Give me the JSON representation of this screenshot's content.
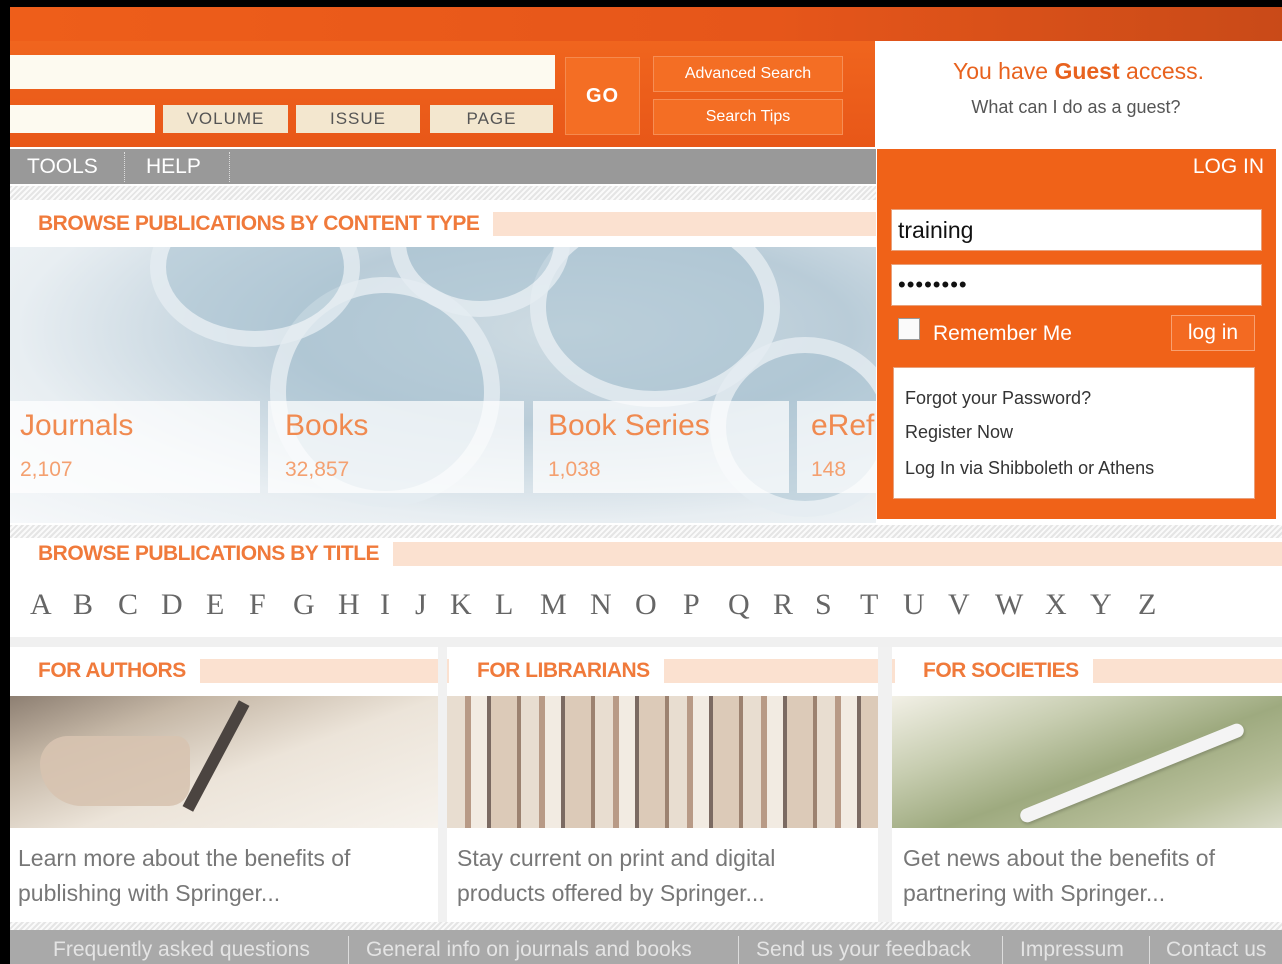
{
  "search": {
    "main_value": "",
    "field_value": "",
    "volume_label": "VOLUME",
    "issue_label": "ISSUE",
    "page_label": "PAGE",
    "go_label": "GO",
    "advanced_label": "Advanced Search",
    "tips_label": "Search Tips"
  },
  "guest": {
    "prefix": "You have ",
    "strong": "Guest",
    "suffix": " access.",
    "question": "What can I do as a guest?"
  },
  "nav": {
    "items": [
      "TOOLS",
      "HELP"
    ]
  },
  "login": {
    "header": "LOG IN",
    "username": "training",
    "password": "••••••••",
    "remember_label": "Remember Me",
    "remember_checked": false,
    "button": "log in",
    "links": [
      "Forgot your Password?",
      "Register Now",
      "Log In via Shibboleth or Athens"
    ]
  },
  "content_type": {
    "title": "BROWSE PUBLICATIONS BY CONTENT TYPE",
    "cards": [
      {
        "label": "Journals",
        "count": "2,107"
      },
      {
        "label": "Books",
        "count": "32,857"
      },
      {
        "label": "Book Series",
        "count": "1,038"
      },
      {
        "label": "eRef",
        "count": "148"
      }
    ]
  },
  "title_browse": {
    "title": "BROWSE PUBLICATIONS BY TITLE",
    "letters": [
      "A",
      "B",
      "C",
      "D",
      "E",
      "F",
      "G",
      "H",
      "I",
      "J",
      "K",
      "L",
      "M",
      "N",
      "O",
      "P",
      "Q",
      "R",
      "S",
      "T",
      "U",
      "V",
      "W",
      "X",
      "Y",
      "Z"
    ]
  },
  "promos": [
    {
      "title": "FOR AUTHORS",
      "line1": "Learn more about the benefits of",
      "line2": "publishing with Springer..."
    },
    {
      "title": "FOR LIBRARIANS",
      "line1": "Stay current on print and digital",
      "line2": "products offered by Springer..."
    },
    {
      "title": "FOR SOCIETIES",
      "line1": "Get news about the benefits of",
      "line2": "partnering with Springer..."
    }
  ],
  "footer": {
    "links": [
      "Frequently asked questions",
      "General info on journals and books",
      "Send us your feedback",
      "Impressum",
      "Contact us"
    ]
  },
  "colors": {
    "brand_orange": "#f06218",
    "nav_gray": "#999999",
    "section_text": "#f07a3b"
  }
}
